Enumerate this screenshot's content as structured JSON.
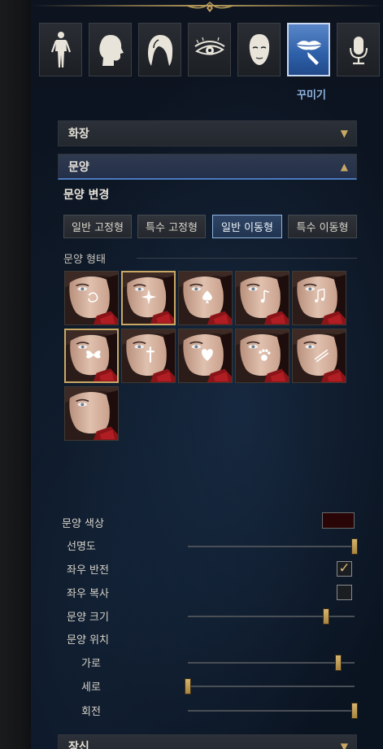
{
  "categories": {
    "tabs": [
      {
        "icon": "body-icon",
        "active": false
      },
      {
        "icon": "head-icon",
        "active": false
      },
      {
        "icon": "hair-icon",
        "active": false
      },
      {
        "icon": "eye-icon",
        "active": false
      },
      {
        "icon": "face-icon",
        "active": false
      },
      {
        "icon": "makeup-icon",
        "active": true
      },
      {
        "icon": "voice-icon",
        "active": false
      }
    ],
    "active_label": "꾸미기"
  },
  "accordion": {
    "makeup_label": "화장",
    "pattern_label": "문양",
    "accessory_label": "장신"
  },
  "pattern": {
    "change_title": "문양 변경",
    "types": [
      "일반 고정형",
      "특수 고정형",
      "일반 이동형",
      "특수 이동형"
    ],
    "selected_type_index": 2,
    "shape_label": "문양 형태",
    "thumbnails": [
      {
        "mark": "swirl",
        "selected": false
      },
      {
        "mark": "sparkle",
        "selected": true
      },
      {
        "mark": "spade",
        "selected": false
      },
      {
        "mark": "note",
        "selected": false
      },
      {
        "mark": "notes",
        "selected": false
      },
      {
        "mark": "butterfly",
        "selected": true
      },
      {
        "mark": "cross",
        "selected": false
      },
      {
        "mark": "heart",
        "selected": false
      },
      {
        "mark": "paw",
        "selected": false
      },
      {
        "mark": "slash",
        "selected": false
      },
      {
        "mark": "none",
        "selected": false
      }
    ]
  },
  "settings": {
    "color_label": "문양 색상",
    "color_value": "#2a0508",
    "clarity_label": "선명도",
    "clarity_value": 1.0,
    "flip_label": "좌우 반전",
    "flip_checked": true,
    "copy_label": "좌우 복사",
    "copy_checked": false,
    "size_label": "문양 크기",
    "size_value": 0.83,
    "position_label": "문양 위치",
    "horizontal_label": "가로",
    "horizontal_value": 0.9,
    "vertical_label": "세로",
    "vertical_value": 0.0,
    "rotation_label": "회전",
    "rotation_value": 1.0
  },
  "colors": {
    "accent_gold": "#c9a865",
    "accent_blue": "#4b79c0"
  }
}
